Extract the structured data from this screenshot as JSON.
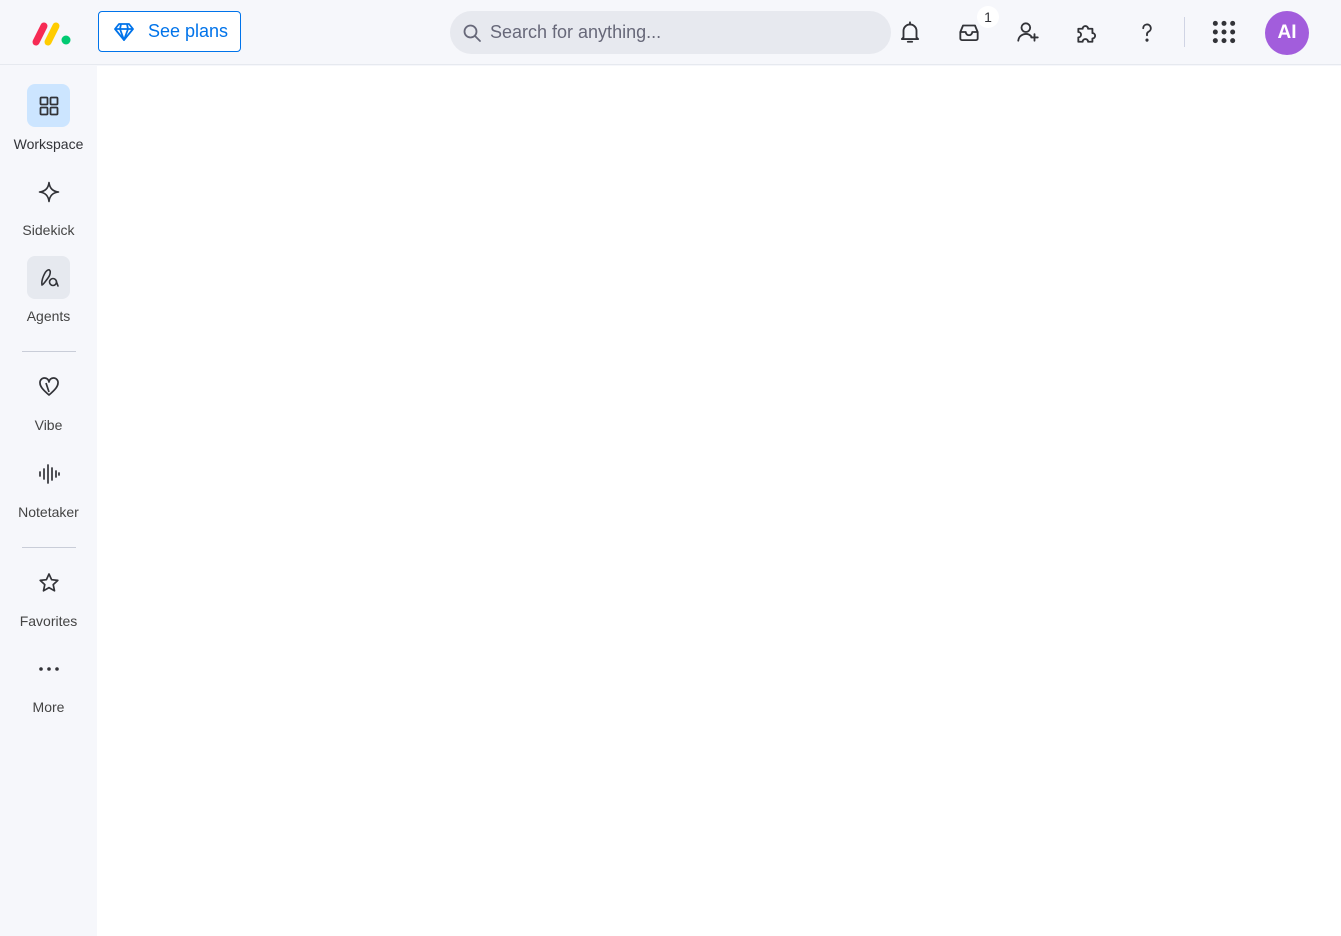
{
  "header": {
    "see_plans_label": "See plans",
    "search_placeholder": "Search for anything...",
    "inbox_badge": "1",
    "avatar_initials": "AI"
  },
  "sidebar": {
    "items": [
      {
        "label": "Workspace",
        "icon": "workspace-icon",
        "active": true
      },
      {
        "label": "Sidekick",
        "icon": "sparkle-icon"
      },
      {
        "label": "Agents",
        "icon": "agents-icon"
      },
      {
        "label": "Vibe",
        "icon": "heart-icon"
      },
      {
        "label": "Notetaker",
        "icon": "waveform-icon"
      },
      {
        "label": "Favorites",
        "icon": "star-icon"
      },
      {
        "label": "More",
        "icon": "more-icon"
      }
    ]
  },
  "colors": {
    "accent": "#0073ea",
    "avatar": "#a25ddc",
    "active_nav": "#cce5ff",
    "logo_red": "#f62b54",
    "logo_yellow": "#ffcc00",
    "logo_green": "#00ca72"
  }
}
